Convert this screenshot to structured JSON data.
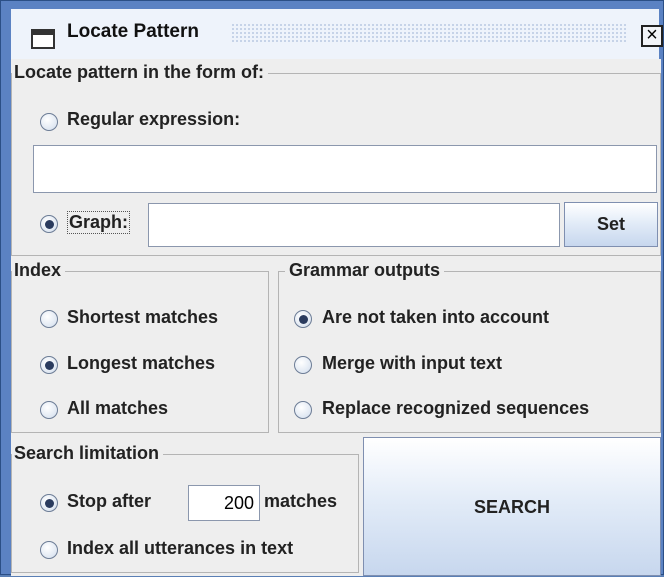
{
  "window": {
    "title": "Locate Pattern",
    "close_icon": "close-x-icon"
  },
  "locate": {
    "group_title": "Locate pattern in the form of:",
    "regex_label": "Regular expression:",
    "regex_value": "",
    "graph_label": "Graph:",
    "graph_value": "",
    "set_label": "Set",
    "selected": "graph"
  },
  "index": {
    "group_title": "Index",
    "options": [
      "Shortest matches",
      "Longest matches",
      "All matches"
    ],
    "selected": "Longest matches"
  },
  "grammar": {
    "group_title": "Grammar outputs",
    "options": [
      "Are not taken into account",
      "Merge with input text",
      "Replace recognized sequences"
    ],
    "selected": "Are not taken into account"
  },
  "limit": {
    "group_title": "Search limitation",
    "stop_label": "Stop after",
    "stop_value": "200",
    "matches_label": "matches",
    "all_label": "Index all utterances in text",
    "selected": "Stop after"
  },
  "search_label": "SEARCH"
}
